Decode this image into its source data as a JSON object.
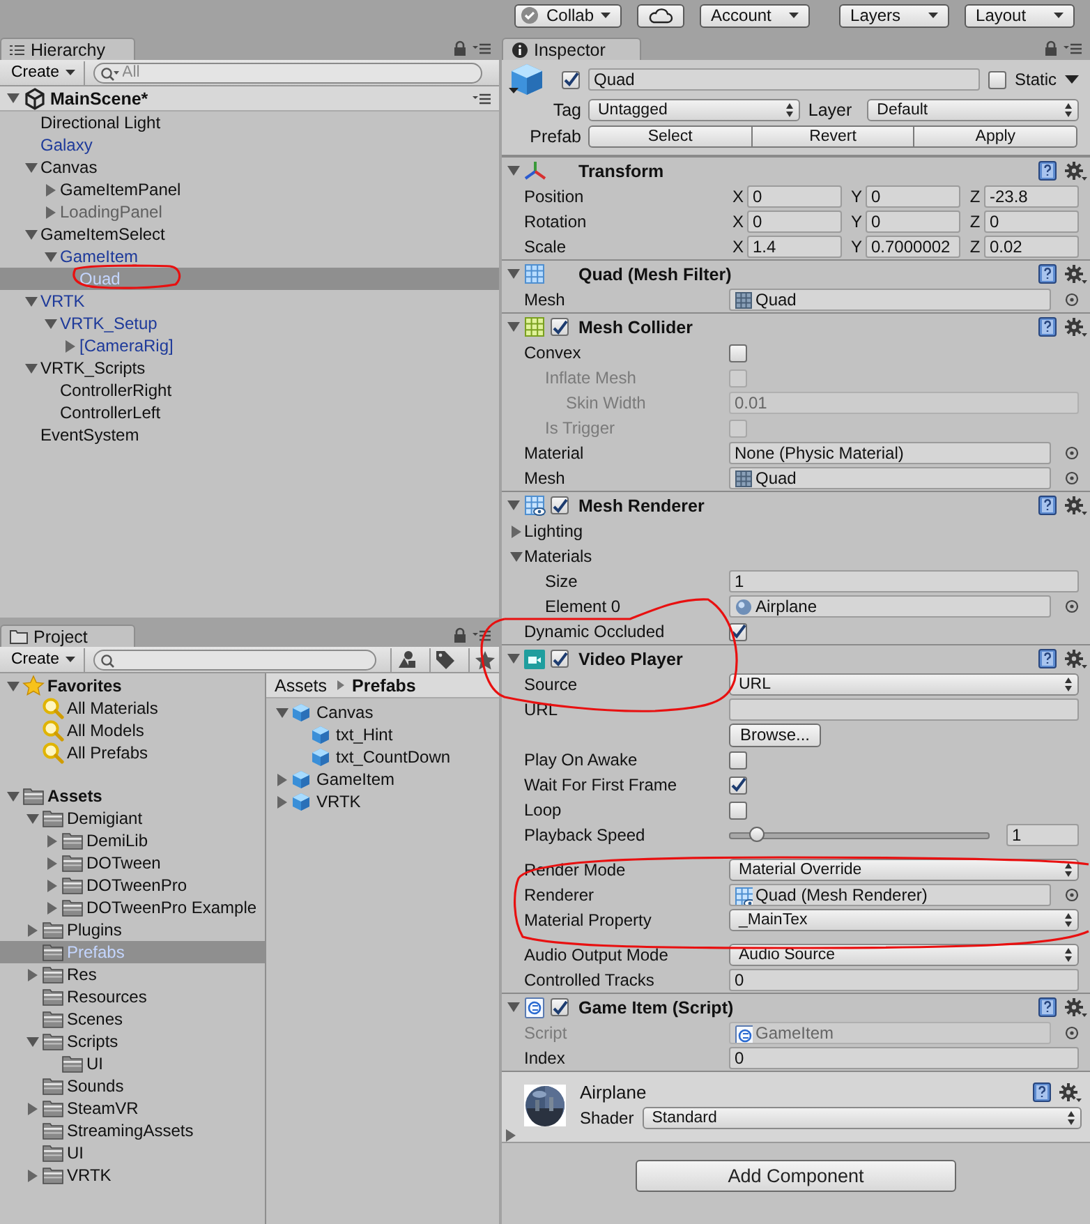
{
  "toolbar": {
    "buttons": [
      {
        "kind": "collab",
        "label": "Collab"
      },
      {
        "kind": "cloud"
      },
      {
        "kind": "dropdown",
        "label": "Account"
      },
      {
        "kind": "dropdown",
        "label": "Layers"
      },
      {
        "kind": "dropdown",
        "label": "Layout"
      }
    ]
  },
  "hierarchy": {
    "tab": "Hierarchy",
    "create": "Create",
    "search_placeholder": "All",
    "scene": {
      "label": "MainScene*",
      "expanded": true,
      "children": [
        {
          "label": "Directional Light",
          "kind": "object",
          "selected": false
        },
        {
          "label": "Galaxy",
          "kind": "prefab",
          "selected": false
        },
        {
          "label": "Canvas",
          "kind": "object",
          "selected": false,
          "expanded": true,
          "children": [
            {
              "label": "GameItemPanel",
              "kind": "object",
              "selected": false,
              "expanded": false
            },
            {
              "label": "LoadingPanel",
              "kind": "inactive",
              "selected": false,
              "expanded": false
            }
          ]
        },
        {
          "label": "GameItemSelect",
          "kind": "object",
          "selected": false,
          "expanded": true,
          "children": [
            {
              "label": "GameItem",
              "kind": "prefab",
              "selected": false,
              "expanded": true,
              "children": [
                {
                  "label": "Quad",
                  "kind": "prefab",
                  "selected": true
                }
              ]
            }
          ]
        },
        {
          "label": "VRTK",
          "kind": "prefab",
          "selected": false,
          "expanded": true,
          "children": [
            {
              "label": "VRTK_Setup",
              "kind": "prefab",
              "selected": false,
              "expanded": true,
              "children": [
                {
                  "label": "[CameraRig]",
                  "kind": "prefab",
                  "selected": false,
                  "expanded": false
                }
              ]
            }
          ]
        },
        {
          "label": "VRTK_Scripts",
          "kind": "object",
          "selected": false,
          "expanded": true,
          "children": [
            {
              "label": "ControllerRight",
              "kind": "object",
              "selected": false
            },
            {
              "label": "ControllerLeft",
              "kind": "object",
              "selected": false
            }
          ]
        },
        {
          "label": "EventSystem",
          "kind": "object",
          "selected": false
        }
      ]
    }
  },
  "project": {
    "tab": "Project",
    "create": "Create",
    "favorites": {
      "label": "Favorites",
      "expanded": true,
      "children": [
        {
          "label": "All Materials",
          "kind": "search",
          "selected": false
        },
        {
          "label": "All Models",
          "kind": "search",
          "selected": false
        },
        {
          "label": "All Prefabs",
          "kind": "search",
          "selected": false
        }
      ]
    },
    "assets": {
      "label": "Assets",
      "expanded": true,
      "children": [
        {
          "label": "Demigiant",
          "kind": "folder",
          "selected": false,
          "expanded": true,
          "children": [
            {
              "label": "DemiLib",
              "kind": "folder",
              "selected": false,
              "expanded": false
            },
            {
              "label": "DOTween",
              "kind": "folder",
              "selected": false,
              "expanded": false
            },
            {
              "label": "DOTweenPro",
              "kind": "folder",
              "selected": false,
              "expanded": false
            },
            {
              "label": "DOTweenPro Example",
              "kind": "folder",
              "selected": false,
              "expanded": false
            }
          ]
        },
        {
          "label": "Plugins",
          "kind": "folder",
          "selected": false,
          "expanded": false
        },
        {
          "label": "Prefabs",
          "kind": "folder",
          "selected": true
        },
        {
          "label": "Res",
          "kind": "folder",
          "selected": false,
          "expanded": false
        },
        {
          "label": "Resources",
          "kind": "folder",
          "selected": false
        },
        {
          "label": "Scenes",
          "kind": "folder",
          "selected": false
        },
        {
          "label": "Scripts",
          "kind": "folder",
          "selected": false,
          "expanded": true,
          "children": [
            {
              "label": "UI",
              "kind": "folder",
              "selected": false
            }
          ]
        },
        {
          "label": "Sounds",
          "kind": "folder",
          "selected": false
        },
        {
          "label": "SteamVR",
          "kind": "folder",
          "selected": false,
          "expanded": false
        },
        {
          "label": "StreamingAssets",
          "kind": "folder",
          "selected": false
        },
        {
          "label": "UI",
          "kind": "folder",
          "selected": false
        },
        {
          "label": "VRTK",
          "kind": "folder",
          "selected": false,
          "expanded": false
        }
      ]
    },
    "breadcrumb": [
      "Assets",
      "Prefabs"
    ],
    "files": [
      {
        "label": "Canvas",
        "selected": false,
        "expanded": true,
        "children": [
          {
            "label": "txt_Hint",
            "selected": false
          },
          {
            "label": "txt_CountDown",
            "selected": false
          }
        ]
      },
      {
        "label": "GameItem",
        "selected": false,
        "expanded": false
      },
      {
        "label": "VRTK",
        "selected": false,
        "expanded": false
      }
    ]
  },
  "inspector": {
    "tab": "Inspector",
    "object": {
      "active": true,
      "name": "Quad",
      "static": false,
      "static_label": "Static",
      "tag_label": "Tag",
      "tag": "Untagged",
      "layer_label": "Layer",
      "layer": "Default",
      "prefab_label": "Prefab",
      "prefab_buttons": [
        "Select",
        "Revert",
        "Apply"
      ]
    },
    "components": [
      {
        "kind": "transform",
        "title": "Transform",
        "expanded": true,
        "rows": [
          {
            "kind": "vector3",
            "label": "Position",
            "fields": [
              {
                "axis": "X",
                "value": "0"
              },
              {
                "axis": "Y",
                "value": "0"
              },
              {
                "axis": "Z",
                "value": "-23.8"
              }
            ]
          },
          {
            "kind": "vector3",
            "label": "Rotation",
            "fields": [
              {
                "axis": "X",
                "value": "0"
              },
              {
                "axis": "Y",
                "value": "0"
              },
              {
                "axis": "Z",
                "value": "0"
              }
            ]
          },
          {
            "kind": "vector3",
            "label": "Scale",
            "fields": [
              {
                "axis": "X",
                "value": "1.4"
              },
              {
                "axis": "Y",
                "value": "0.7000002"
              },
              {
                "axis": "Z",
                "value": "0.02"
              }
            ]
          }
        ]
      },
      {
        "kind": "mesh_filter",
        "title": "Quad (Mesh Filter)",
        "expanded": true,
        "rows": [
          {
            "kind": "mesh",
            "label": "Mesh",
            "value": "Quad"
          }
        ]
      },
      {
        "kind": "mesh_collider",
        "title": "Mesh Collider",
        "enabled": true,
        "expanded": true,
        "rows": [
          {
            "kind": "checkbox",
            "label": "Convex",
            "checked": false,
            "children": [
              {
                "kind": "checkbox",
                "label": "Inflate Mesh",
                "checked": false,
                "disabled": true,
                "children": [
                  {
                    "kind": "text",
                    "label": "Skin Width",
                    "value": "0.01",
                    "disabled": true
                  }
                ]
              },
              {
                "kind": "checkbox",
                "label": "Is Trigger",
                "checked": false,
                "disabled": true
              }
            ]
          },
          {
            "kind": "object",
            "label": "Material",
            "value": "None (Physic Material)"
          },
          {
            "kind": "mesh",
            "label": "Mesh",
            "value": "Quad"
          }
        ]
      },
      {
        "kind": "mesh_renderer",
        "title": "Mesh Renderer",
        "enabled": true,
        "expanded": true,
        "rows": [
          {
            "kind": "foldout",
            "label": "Lighting",
            "expanded": false
          },
          {
            "kind": "foldout",
            "label": "Materials",
            "expanded": true,
            "children": [
              {
                "kind": "text",
                "label": "Size",
                "value": "1"
              },
              {
                "kind": "material",
                "label": "Element 0",
                "value": "Airplane"
              }
            ]
          },
          {
            "kind": "checkbox",
            "label": "Dynamic Occluded",
            "checked": true
          }
        ]
      },
      {
        "kind": "video_player",
        "title": "Video Player",
        "enabled": true,
        "expanded": true,
        "rows": [
          {
            "kind": "dropdown",
            "label": "Source",
            "value": "URL"
          },
          {
            "kind": "text",
            "label": "URL"
          },
          {
            "kind": "button",
            "button": "Browse..."
          },
          {
            "kind": "checkbox",
            "label": "Play On Awake",
            "checked": false
          },
          {
            "kind": "checkbox",
            "label": "Wait For First Frame",
            "checked": true
          },
          {
            "kind": "checkbox",
            "label": "Loop",
            "checked": false
          },
          {
            "kind": "slider",
            "label": "Playback Speed",
            "level": 0.1,
            "value": "1"
          },
          {
            "kind": "dropdown",
            "label": "Render Mode",
            "value": "Material Override"
          },
          {
            "kind": "renderer",
            "label": "Renderer",
            "value": "Quad (Mesh Renderer)"
          },
          {
            "kind": "dropdown",
            "label": "Material Property",
            "value": "_MainTex"
          },
          {
            "kind": "dropdown",
            "label": "Audio Output Mode",
            "value": "Audio Source"
          },
          {
            "kind": "text",
            "label": "Controlled Tracks",
            "value": "0"
          }
        ]
      },
      {
        "kind": "script",
        "title": "Game Item (Script)",
        "enabled": true,
        "expanded": true,
        "rows": [
          {
            "kind": "script",
            "label": "Script",
            "value": "GameItem",
            "disabled": true
          },
          {
            "kind": "text",
            "label": "Index",
            "value": "0"
          }
        ]
      }
    ],
    "material": {
      "name": "Airplane",
      "expanded": false,
      "shader_label": "Shader",
      "shader": "Standard"
    },
    "add_component": "Add Component"
  }
}
